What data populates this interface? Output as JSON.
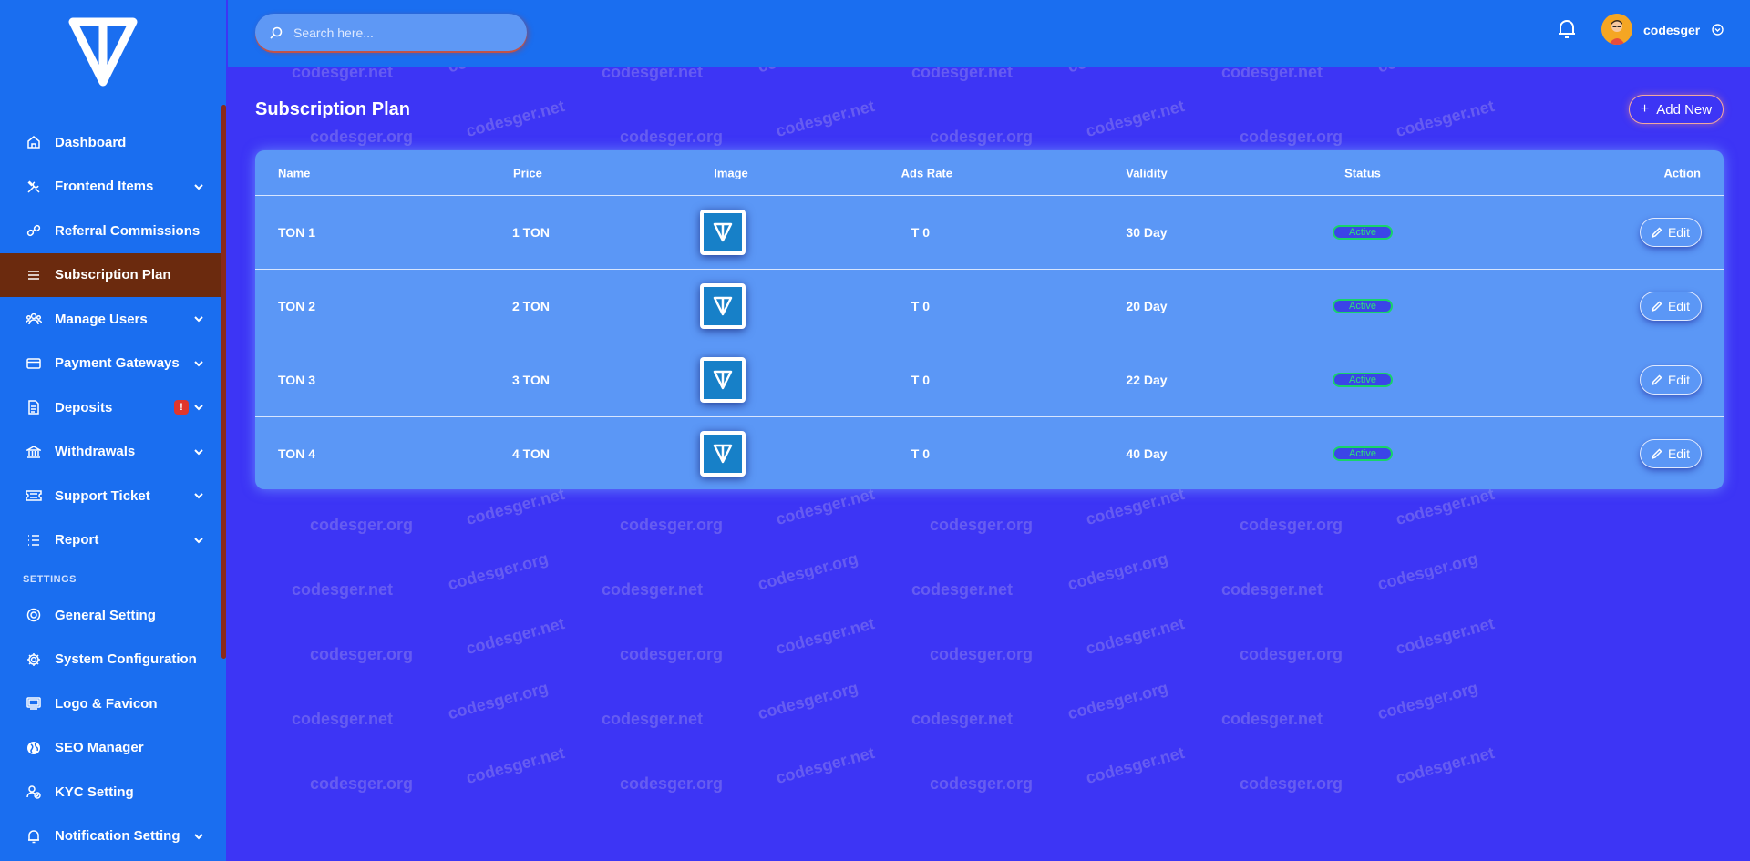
{
  "sidebar": {
    "menu": [
      {
        "label": "Dashboard",
        "icon": "home-icon",
        "chevron": false
      },
      {
        "label": "Frontend Items",
        "icon": "tools-icon",
        "chevron": true
      },
      {
        "label": "Referral Commissions",
        "icon": "link-icon",
        "chevron": false
      },
      {
        "label": "Subscription Plan",
        "icon": "list-icon",
        "chevron": false,
        "active": true
      },
      {
        "label": "Manage Users",
        "icon": "users-icon",
        "chevron": true
      },
      {
        "label": "Payment Gateways",
        "icon": "credit-card-icon",
        "chevron": true
      },
      {
        "label": "Deposits",
        "icon": "receipt-icon",
        "chevron": true,
        "badge": "!"
      },
      {
        "label": "Withdrawals",
        "icon": "bank-icon",
        "chevron": true
      },
      {
        "label": "Support Ticket",
        "icon": "ticket-icon",
        "chevron": true
      },
      {
        "label": "Report",
        "icon": "report-list-icon",
        "chevron": true
      }
    ],
    "settings_title": "SETTINGS",
    "settings": [
      {
        "label": "General Setting",
        "icon": "target-icon",
        "chevron": false
      },
      {
        "label": "System Configuration",
        "icon": "gear-icon",
        "chevron": false
      },
      {
        "label": "Logo & Favicon",
        "icon": "image-icon",
        "chevron": false
      },
      {
        "label": "SEO Manager",
        "icon": "globe-icon",
        "chevron": false
      },
      {
        "label": "KYC Setting",
        "icon": "user-check-icon",
        "chevron": false
      },
      {
        "label": "Notification Setting",
        "icon": "bell-icon",
        "chevron": true
      }
    ]
  },
  "header": {
    "search_placeholder": "Search here...",
    "username": "codesger"
  },
  "page": {
    "title": "Subscription Plan",
    "add_label": "Add New"
  },
  "table": {
    "columns": [
      "Name",
      "Price",
      "Image",
      "Ads Rate",
      "Validity",
      "Status",
      "Action"
    ],
    "rows": [
      {
        "name": "TON 1",
        "price": "1 TON",
        "ads_rate": "T 0",
        "validity": "30 Day",
        "status": "Active",
        "action": "Edit"
      },
      {
        "name": "TON 2",
        "price": "2 TON",
        "ads_rate": "T 0",
        "validity": "20 Day",
        "status": "Active",
        "action": "Edit"
      },
      {
        "name": "TON 3",
        "price": "3 TON",
        "ads_rate": "T 0",
        "validity": "22 Day",
        "status": "Active",
        "action": "Edit"
      },
      {
        "name": "TON 4",
        "price": "4 TON",
        "ads_rate": "T 0",
        "validity": "40 Day",
        "status": "Active",
        "action": "Edit"
      }
    ]
  },
  "watermarks": [
    "codesger.net",
    "codesger.org"
  ],
  "colors": {
    "sidebar": "#1a6ef0",
    "main_bg": "#3d35f5",
    "active_item": "#6b2a0e",
    "status_green": "#18d36a"
  }
}
